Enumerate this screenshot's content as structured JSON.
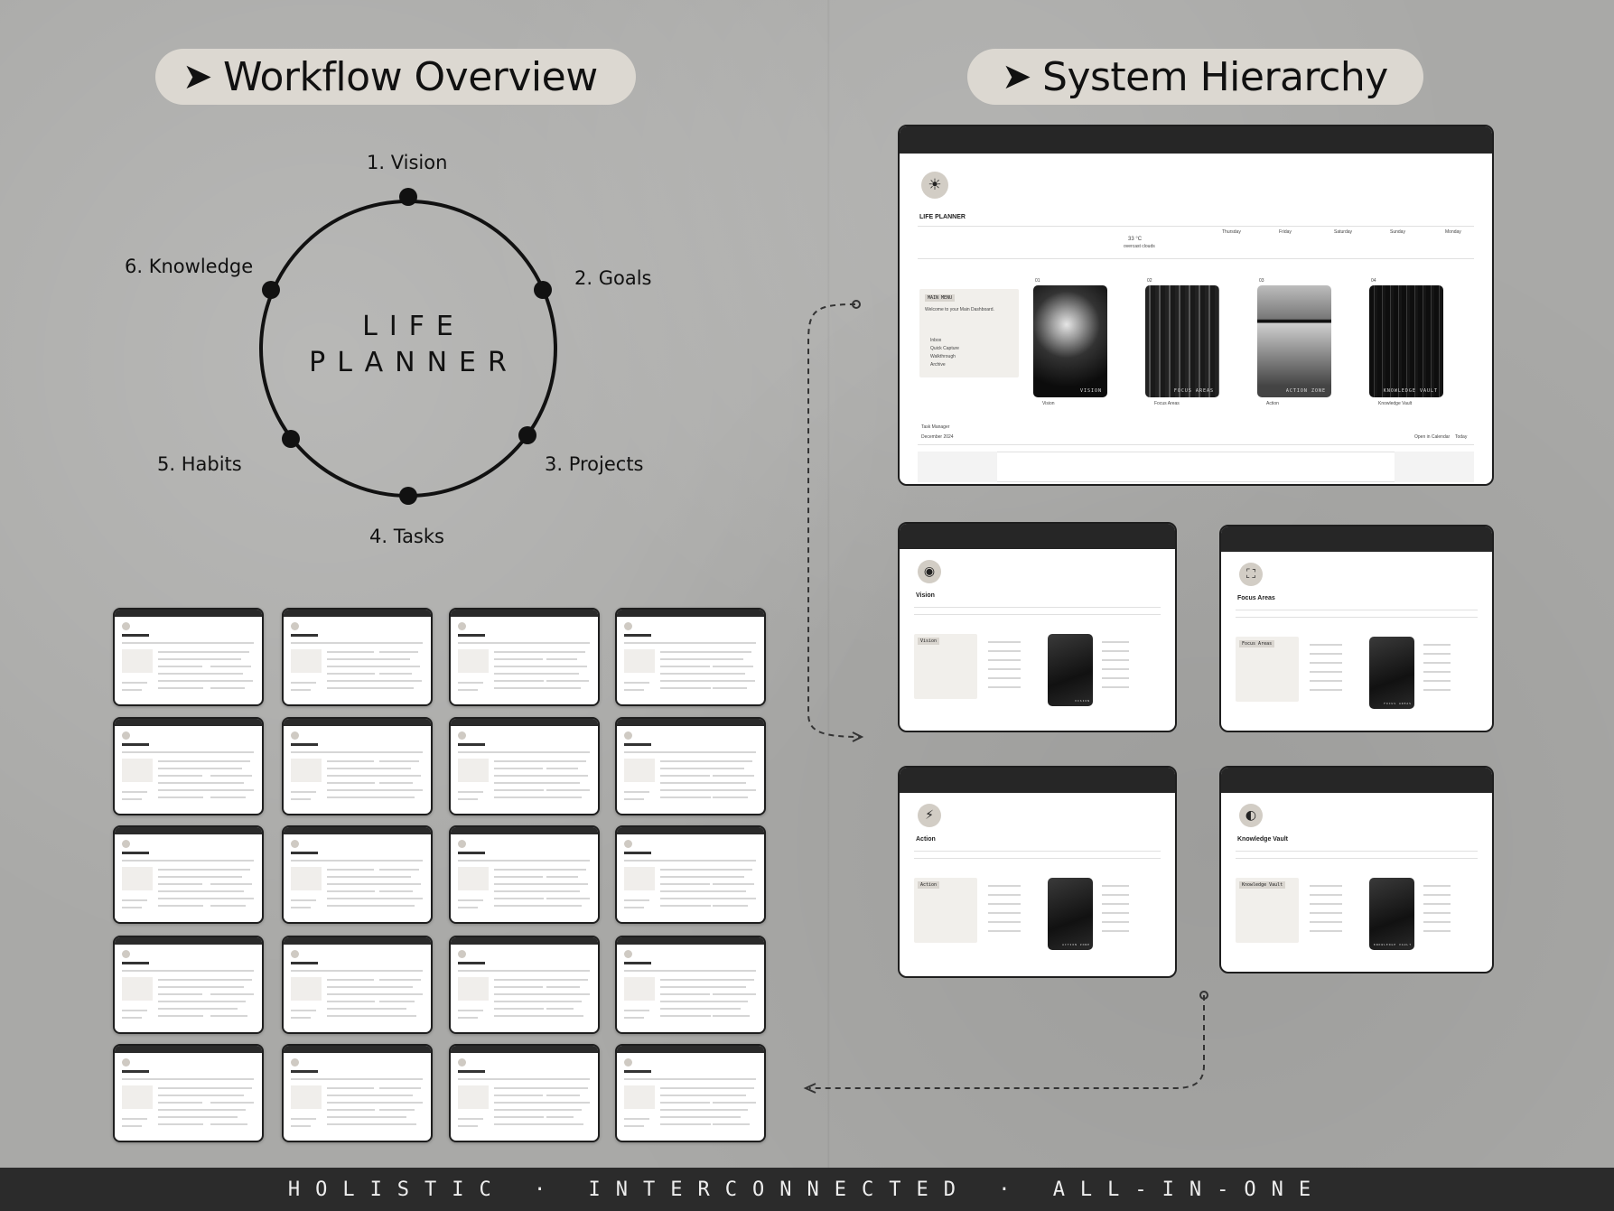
{
  "headings": {
    "workflow": "Workflow Overview",
    "hierarchy": "System Hierarchy",
    "arrow": "➤"
  },
  "cycle": {
    "center_line1": "LIFE",
    "center_line2": "PLANNER",
    "steps": [
      "1. Vision",
      "2. Goals",
      "3. Projects",
      "4. Tasks",
      "5. Habits",
      "6. Knowledge"
    ]
  },
  "dashboard": {
    "title": "LIFE PLANNER",
    "weather": {
      "temp": "33 °C",
      "condition": "overcast clouds",
      "days": [
        "Thursday",
        "Friday",
        "Saturday",
        "Sunday",
        "Monday"
      ]
    },
    "main_note": {
      "tag": "MAIN MENU",
      "text": "Welcome to your Main Dashboard.",
      "links": [
        "Inbox",
        "Quick Capture",
        "Walkthrough",
        "Archive"
      ]
    },
    "cards": [
      {
        "num": "01",
        "caption": "VISION",
        "label": "Vision"
      },
      {
        "num": "02",
        "caption": "FOCUS AREAS",
        "label": "Focus Areas"
      },
      {
        "num": "03",
        "caption": "ACTION ZONE",
        "label": "Action"
      },
      {
        "num": "04",
        "caption": "KNOWLEDGE VAULT",
        "label": "Knowledge Vault"
      }
    ],
    "task_manager": "Task Manager",
    "month": "December 2024",
    "calendar_buttons": [
      "Open in Calendar",
      "Today"
    ]
  },
  "sub_pages": [
    {
      "title": "Vision",
      "tag": "Vision",
      "icon": "◉",
      "caption": "VISION"
    },
    {
      "title": "Focus Areas",
      "tag": "Focus Areas",
      "icon": "⛶",
      "caption": "FOCUS AREAS"
    },
    {
      "title": "Action",
      "tag": "Action",
      "icon": "⚡",
      "caption": "ACTION ZONE"
    },
    {
      "title": "Knowledge Vault",
      "tag": "Knowledge Vault",
      "icon": "◐",
      "caption": "KNOWLEDGE VAULT"
    }
  ],
  "footer": {
    "text": "HOLISTIC · INTERCONNECTED · ALL-IN-ONE"
  },
  "colors": {
    "background": "#a9a9a7",
    "pill": "#dcd8d1",
    "dark": "#2b2b2b"
  }
}
